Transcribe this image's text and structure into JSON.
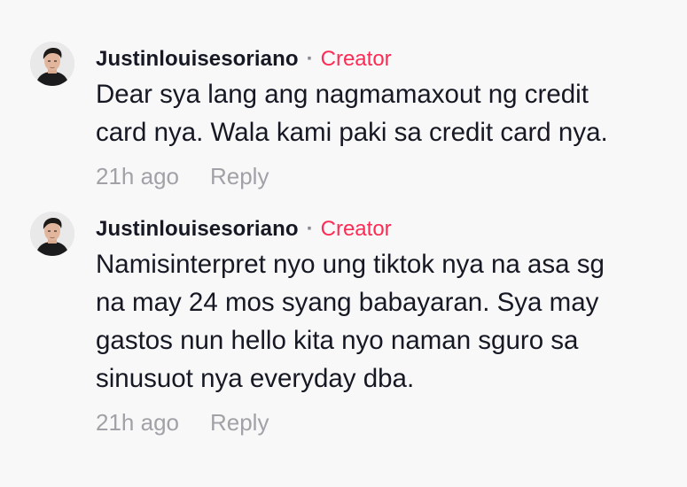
{
  "comments": [
    {
      "username": "Justinlouisesoriano",
      "separator": "·",
      "badge": "Creator",
      "avatar_icon": "user-avatar",
      "lines": [
        "Dear sya lang ang nagmamaxout ng credit",
        "card nya. Wala kami paki sa credit card nya."
      ],
      "time": "21h ago",
      "reply_label": "Reply"
    },
    {
      "username": "Justinlouisesoriano",
      "separator": "·",
      "badge": "Creator",
      "avatar_icon": "user-avatar",
      "lines": [
        "Namisinterpret nyo ung tiktok nya na asa sg",
        "na may 24 mos syang babayaran. Sya may",
        "gastos nun hello kita nyo naman sguro sa",
        "sinusuot nya everyday dba."
      ],
      "time": "21h ago",
      "reply_label": "Reply"
    }
  ],
  "colors": {
    "background": "#f8f8f8",
    "text": "#161823",
    "creator_badge": "#fe2c55",
    "meta": "#a1a2a7"
  }
}
